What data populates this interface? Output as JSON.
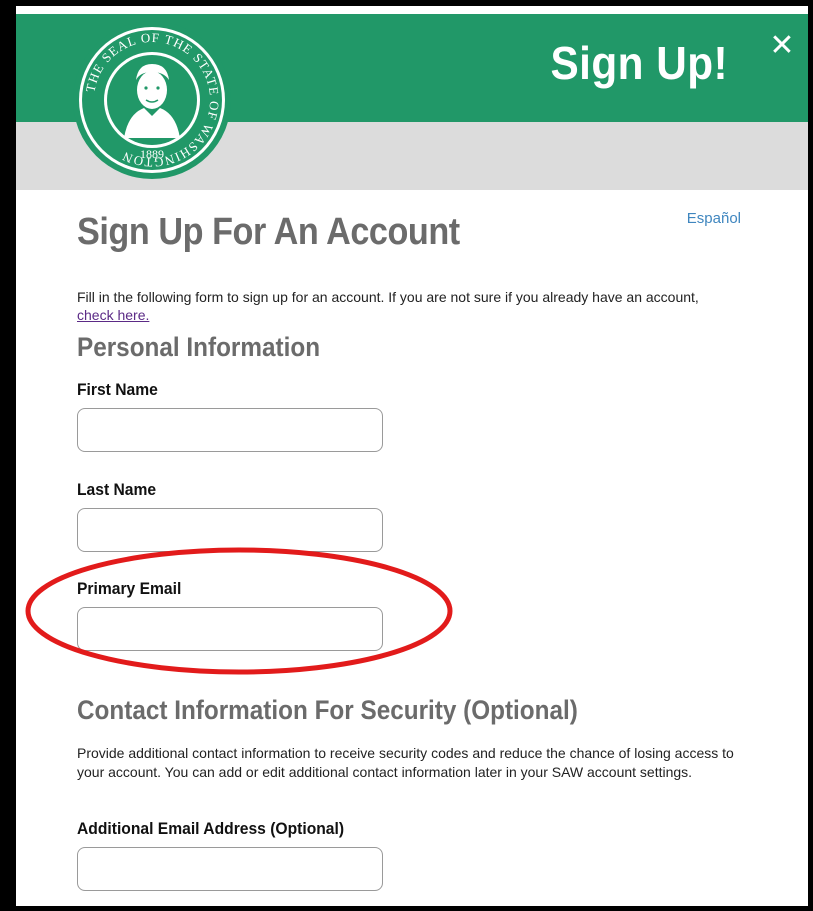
{
  "colors": {
    "brand_green": "#219868",
    "header_gray": "#dcdcdc",
    "heading_gray": "#6b6b6b",
    "link_blue": "#3f86bf",
    "link_visited": "#5b2a86",
    "highlight_red": "#e21b1b"
  },
  "header": {
    "title": "Sign Up!",
    "close_label": "✕",
    "seal": {
      "ring_text": "THE SEAL OF THE STATE OF WASHINGTON",
      "year": "1889"
    }
  },
  "language_link": "Español",
  "page": {
    "title": "Sign Up For An Account",
    "intro_text": "Fill in the following form to sign up for an account. If you are not sure if you already have an account,",
    "intro_link": "check here."
  },
  "personal": {
    "section_title": "Personal Information",
    "first_name_label": "First Name",
    "first_name_value": "",
    "last_name_label": "Last Name",
    "last_name_value": "",
    "primary_email_label": "Primary Email",
    "primary_email_value": ""
  },
  "security": {
    "section_title": "Contact Information For Security (Optional)",
    "description": "Provide additional contact information to receive security codes and reduce the chance of losing access to your account. You can add or edit additional contact information later in your SAW account settings.",
    "additional_email_label": "Additional Email Address (Optional)",
    "additional_email_value": ""
  }
}
